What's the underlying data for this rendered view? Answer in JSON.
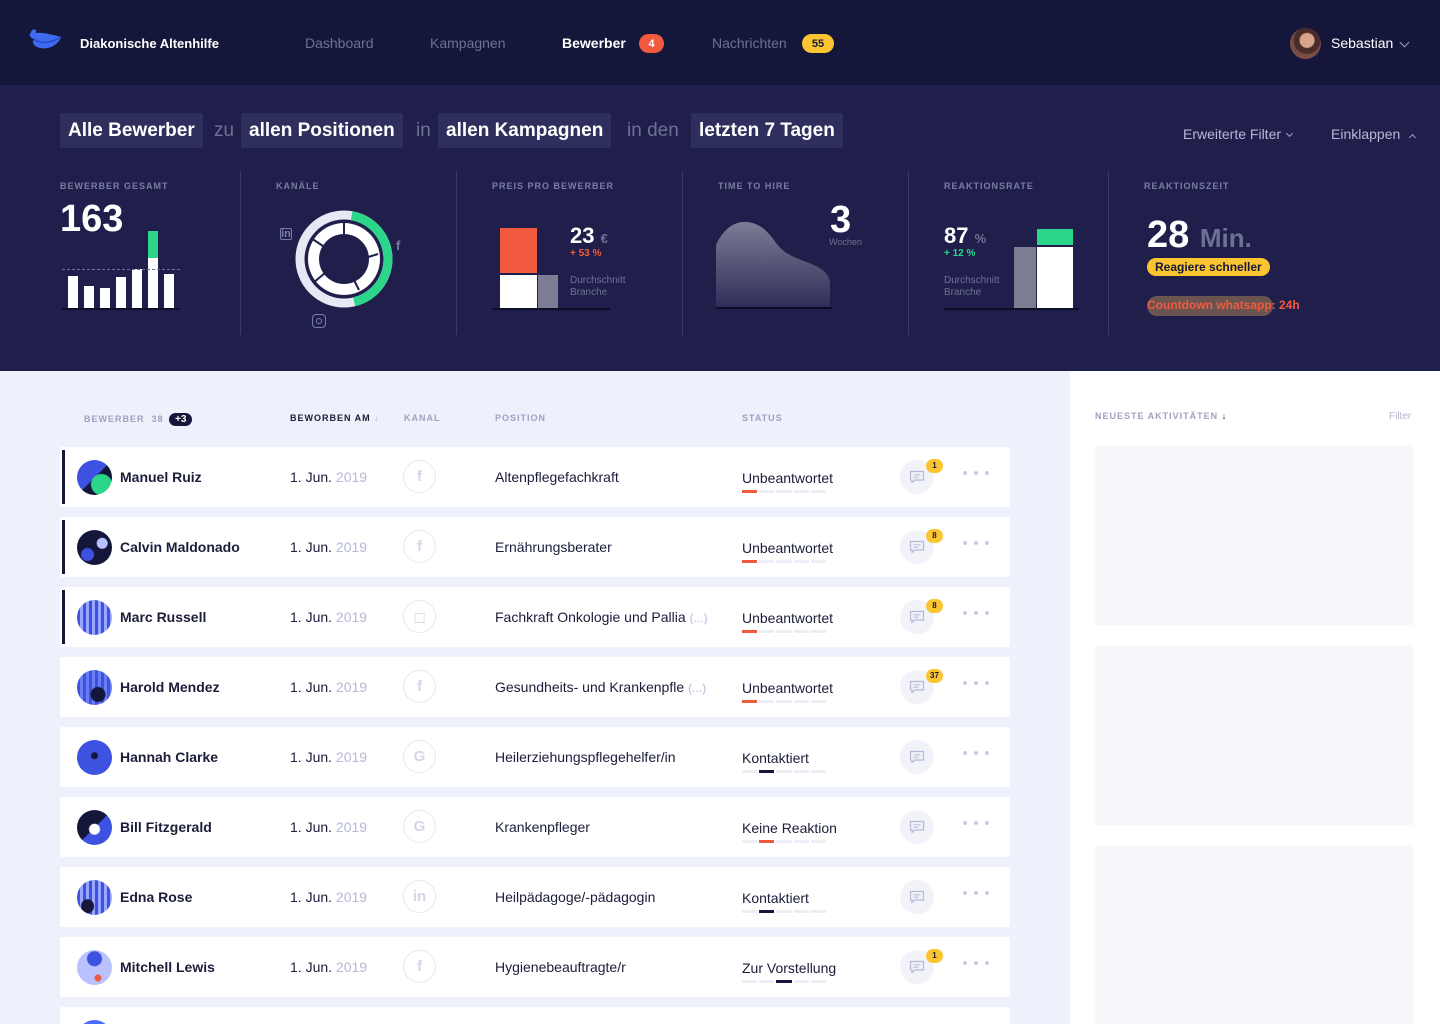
{
  "nav": {
    "brand": "Diakonische Altenhilfe",
    "items": [
      {
        "label": "Dashboard"
      },
      {
        "label": "Kampagnen"
      },
      {
        "label": "Bewerber",
        "badge": "4"
      },
      {
        "label": "Nachrichten",
        "badge": "55"
      }
    ],
    "user": "Sebastian"
  },
  "filters": {
    "pill1": "Alle Bewerber",
    "word1": "zu",
    "pill2": "allen Positionen",
    "word2": "in",
    "pill3": "allen Kampagnen",
    "word3": "in den",
    "pill4": "letzten 7 Tagen",
    "advanced": "Erweiterte Filter",
    "collapse": "Einklappen"
  },
  "kpis": {
    "total": {
      "label": "BEWERBER GESAMT",
      "value": "163",
      "bars": [
        0.45,
        0.32,
        0.28,
        0.44,
        0.55,
        0.71,
        0.48
      ],
      "highlight_index": 5,
      "highlight_extra": 0.49
    },
    "channels": {
      "label": "KANÄLE"
    },
    "price": {
      "label": "PREIS PRO BEWERBER",
      "value": "23",
      "unit": "€",
      "delta": "+ 53 %",
      "sub1": "Durchschnitt",
      "sub2": "Branche"
    },
    "time_to_hire": {
      "label": "TIME TO HIRE",
      "value": "3",
      "unit": "Wochen"
    },
    "reaction_rate": {
      "label": "REAKTIONSRATE",
      "value": "87",
      "unit": "%",
      "delta": "+ 12 %",
      "sub1": "Durchschnitt",
      "sub2": "Branche"
    },
    "reaction_time": {
      "label": "REAKTIONSZEIT",
      "value": "28",
      "unit": "Min.",
      "cta": "Reagiere schneller",
      "countdown": "Countdown whatsapp: 24h"
    }
  },
  "table": {
    "headers": {
      "applicants": "BEWERBER",
      "count": "38",
      "count_new": "+3",
      "applied": "BEWORBEN AM",
      "channel": "KANAL",
      "position": "POSITION",
      "status": "STATUS"
    },
    "rows": [
      {
        "name": "Manuel Ruiz",
        "day": "1. Jun.",
        "year": "2019",
        "channel": "facebook",
        "position": "Altenpflegefachkraft",
        "truncated": false,
        "status": "Unbeantwortet",
        "step": 0,
        "step_color": "red",
        "messages": "1",
        "marked": true
      },
      {
        "name": "Calvin Maldonado",
        "day": "1. Jun.",
        "year": "2019",
        "channel": "facebook",
        "position": "Ernährungsberater",
        "truncated": false,
        "status": "Unbeantwortet",
        "step": 0,
        "step_color": "red",
        "messages": "8",
        "marked": true
      },
      {
        "name": "Marc Russell",
        "day": "1. Jun.",
        "year": "2019",
        "channel": "instagram",
        "position": "Fachkraft Onkologie und Pallia",
        "truncated": true,
        "status": "Unbeantwortet",
        "step": 0,
        "step_color": "red",
        "messages": "8",
        "marked": true
      },
      {
        "name": "Harold Mendez",
        "day": "1. Jun.",
        "year": "2019",
        "channel": "facebook",
        "position": "Gesundheits- und Krankenpfle",
        "truncated": true,
        "status": "Unbeantwortet",
        "step": 0,
        "step_color": "red",
        "messages": "37",
        "marked": false
      },
      {
        "name": "Hannah Clarke",
        "day": "1. Jun.",
        "year": "2019",
        "channel": "google",
        "position": "Heilerziehungspflegehelfer/in",
        "truncated": false,
        "status": "Kontaktiert",
        "step": 1,
        "step_color": "dark",
        "messages": "",
        "marked": false
      },
      {
        "name": "Bill Fitzgerald",
        "day": "1. Jun.",
        "year": "2019",
        "channel": "google",
        "position": "Krankenpfleger",
        "truncated": false,
        "status": "Keine Reaktion",
        "step": 1,
        "step_color": "red",
        "messages": "",
        "marked": false
      },
      {
        "name": "Edna Rose",
        "day": "1. Jun.",
        "year": "2019",
        "channel": "linkedin",
        "position": "Heilpädagoge/-pädagogin",
        "truncated": false,
        "status": "Kontaktiert",
        "step": 1,
        "step_color": "dark",
        "messages": "",
        "marked": false
      },
      {
        "name": "Mitchell Lewis",
        "day": "1. Jun.",
        "year": "2019",
        "channel": "facebook",
        "position": "Hygienebeauftragte/r",
        "truncated": false,
        "status": "Zur Vorstellung",
        "step": 2,
        "step_color": "dark",
        "messages": "1",
        "marked": false
      }
    ],
    "ellipsis": "(...)"
  },
  "sidebar": {
    "title": "NEUESTE AKTIVITÄTEN",
    "filter": "Filter"
  },
  "colors": {
    "accent_red": "#f15a3e",
    "accent_yellow": "#fbc531",
    "accent_green": "#2bd68b",
    "nav_bg": "#15173a",
    "panel_bg": "#201f4b"
  }
}
